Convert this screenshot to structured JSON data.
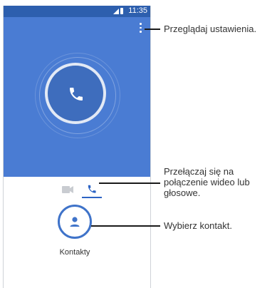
{
  "status": {
    "time": "11:35"
  },
  "contacts": {
    "label": "Kontakty"
  },
  "callouts": {
    "settings": "Przeglądaj ustawienia.",
    "toggle_line1": "Przełączaj się na",
    "toggle_line2": "połączenie wideo lub",
    "toggle_line3": "głosowe.",
    "contact": "Wybierz kontakt."
  },
  "colors": {
    "app_background": "#4a7cd3",
    "status_bar": "#2d5fae",
    "accent": "#3f73c9"
  },
  "icons": {
    "menu": "more-vert-icon",
    "call": "phone-icon",
    "video": "videocam-icon",
    "voice": "phone-icon",
    "contact": "person-icon"
  }
}
